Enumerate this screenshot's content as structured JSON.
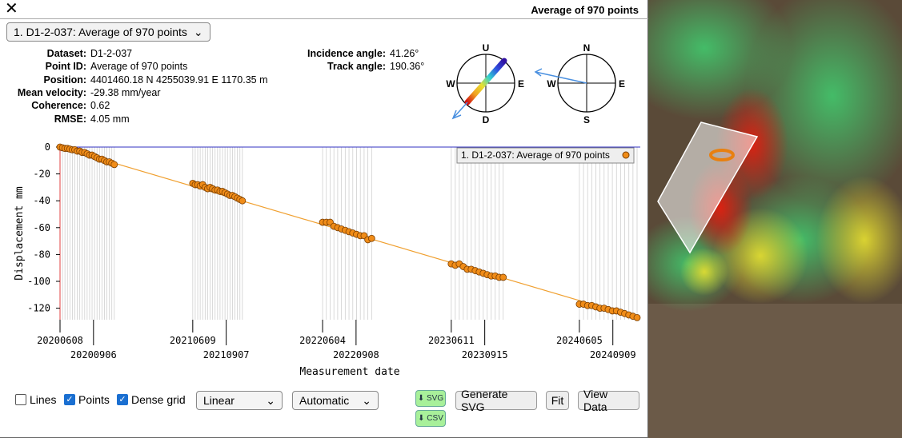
{
  "window": {
    "title": "Average of 970 points",
    "close_icon": "close-icon"
  },
  "point_select": {
    "value": "1. D1-2-037: Average of 970 points"
  },
  "info": {
    "dataset_label": "Dataset:",
    "dataset": "D1-2-037",
    "point_id_label": "Point ID:",
    "point_id": "Average of 970 points",
    "position_label": "Position:",
    "position": "4401460.18 N 4255039.91 E 1170.35 m",
    "velocity_label": "Mean velocity:",
    "velocity": "-29.38 mm/year",
    "coherence_label": "Coherence:",
    "coherence": "0.62",
    "rmse_label": "RMSE:",
    "rmse": "4.05 mm",
    "incidence_label": "Incidence angle:",
    "incidence": "41.26°",
    "track_label": "Track angle:",
    "track": "190.36°"
  },
  "compass_vertical": {
    "top": "U",
    "bottom": "D",
    "left": "W",
    "right": "E"
  },
  "compass_horizontal": {
    "top": "N",
    "bottom": "S",
    "left": "W",
    "right": "E"
  },
  "chart_data": {
    "type": "scatter",
    "xlabel": "Measurement date",
    "ylabel": "Displacement mm",
    "ylim": [
      -130,
      0
    ],
    "yticks": [
      0,
      -20,
      -40,
      -60,
      -80,
      -100,
      -120
    ],
    "xticks": [
      "20200608",
      "20200906",
      "20210609",
      "20210907",
      "20220604",
      "20220908",
      "20230611",
      "20230915",
      "20240605",
      "20240909"
    ],
    "legend": "1. D1-2-037: Average of 970 points",
    "legend_position": "top-right",
    "trend_line": {
      "start": [
        0,
        0
      ],
      "end": [
        1,
        -127
      ]
    },
    "series": [
      {
        "name": "1. D1-2-037: Average of 970 points",
        "seasons": [
          {
            "start_frac": 0.0,
            "end_frac": 0.094,
            "values": [
              0,
              -0.5,
              -1,
              -1,
              -1.5,
              -2,
              -2,
              -3,
              -3,
              -4,
              -4,
              -5,
              -6,
              -6,
              -7,
              -8,
              -9,
              -9,
              -10,
              -11,
              -11,
              -12,
              -13
            ]
          },
          {
            "start_frac": 0.23,
            "end_frac": 0.316,
            "values": [
              -27,
              -28,
              -28,
              -29,
              -28,
              -30,
              -31,
              -30,
              -31,
              -32,
              -32,
              -33,
              -33,
              -34,
              -35,
              -36,
              -36,
              -37,
              -38,
              -39,
              -40
            ]
          },
          {
            "start_frac": 0.455,
            "end_frac": 0.54,
            "values": [
              -56,
              -56,
              -56,
              -59,
              -60,
              -61,
              -62,
              -63,
              -64,
              -65,
              -66,
              -66,
              -69,
              -68
            ]
          },
          {
            "start_frac": 0.678,
            "end_frac": 0.768,
            "values": [
              -87,
              -88,
              -87,
              -89,
              -91,
              -91,
              -92,
              -93,
              -94,
              -95,
              -96,
              -96,
              -97,
              -97
            ]
          },
          {
            "start_frac": 0.9,
            "end_frac": 1.0,
            "values": [
              -117,
              -117,
              -118,
              -118,
              -119,
              -120,
              -120,
              -121,
              -122,
              -122,
              -123,
              -124,
              -125,
              -126,
              -127
            ]
          }
        ]
      }
    ]
  },
  "controls": {
    "lines_label": "Lines",
    "lines_checked": false,
    "points_label": "Points",
    "points_checked": true,
    "grid_label": "Dense grid",
    "grid_checked": true,
    "scale_value": "Linear",
    "axis_value": "Automatic",
    "svg_dl_label": "⬇ SVG",
    "csv_dl_label": "⬇ CSV",
    "generate_svg_label": "Generate SVG",
    "fit_label": "Fit",
    "view_data_label": "View Data"
  },
  "colors": {
    "accent": "#f4a020",
    "trend": "#f0a030",
    "point_fill": "#f08c18",
    "point_stroke": "#7a3e00",
    "arrow": "#4a90e0",
    "check": "#1a6fd1",
    "download_btn": "#a8f09a"
  }
}
